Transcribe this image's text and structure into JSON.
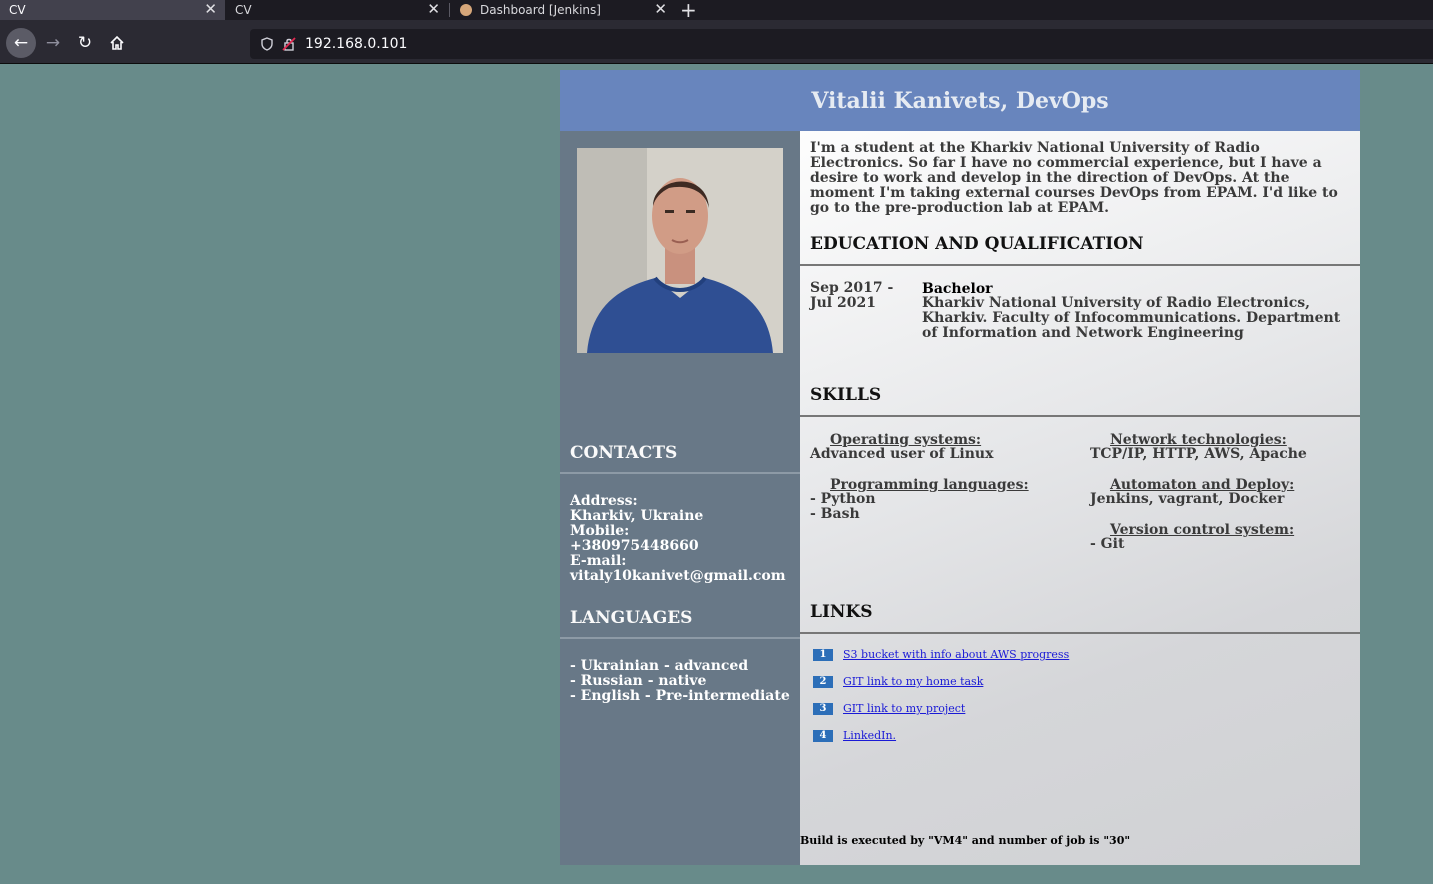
{
  "browser": {
    "tabs": [
      {
        "label": "CV",
        "active": true
      },
      {
        "label": "CV",
        "active": false
      },
      {
        "label": "Dashboard [Jenkins]",
        "active": false
      }
    ],
    "url": "192.168.0.101"
  },
  "cv": {
    "title": "Vitalii Kanivets, DevOps",
    "intro": "I'm a student at the Kharkiv National University of Radio Electronics. So far I have no commercial experience, but I have a desire to work and develop in the direction of DevOps. At the moment I'm taking external courses DevOps from EPAM. I'd like to go to the pre-production lab at EPAM.",
    "contacts": {
      "heading": "CONTACTS",
      "address_label": "Address:",
      "address": "Kharkiv, Ukraine",
      "mobile_label": "Mobile:",
      "mobile": "+380975448660",
      "email_label": "E-mail:",
      "email": "vitaly10kanivet@gmail.com"
    },
    "languages": {
      "heading": "LANGUAGES",
      "items": [
        "- Ukrainian - advanced",
        "- Russian - native",
        "- English - Pre-intermediate"
      ]
    },
    "education": {
      "heading": "EDUCATION AND QUALIFICATION",
      "date_start": "Sep 2017 -",
      "date_end": "Jul 2021",
      "degree": "Bachelor",
      "description": "Kharkiv National University of Radio Electronics, Kharkiv. Faculty of Infocommunications. Department of Information and Network Engineering"
    },
    "skills": {
      "heading": "SKILLS",
      "os_heading": "Operating systems:",
      "os_text": "Advanced user of Linux",
      "prog_heading": "Programming languages:",
      "prog_items": [
        "- Python",
        "- Bash"
      ],
      "net_heading": "Network technologies:",
      "net_text": "TCP/IP, HTTP, AWS, Apache",
      "auto_heading": "Automaton and Deploy:",
      "auto_text": "Jenkins, vagrant, Docker",
      "vcs_heading": "Version control system:",
      "vcs_text": "- Git"
    },
    "links": {
      "heading": "LINKS",
      "items": [
        {
          "num": "1",
          "label": "S3 bucket with info about AWS progress"
        },
        {
          "num": "2",
          "label": "GIT link to my home task"
        },
        {
          "num": "3",
          "label": "GIT link to my project"
        },
        {
          "num": "4",
          "label": "LinkedIn."
        }
      ]
    },
    "build": "Build is executed by \"VM4\" and number of job is \"30\""
  }
}
